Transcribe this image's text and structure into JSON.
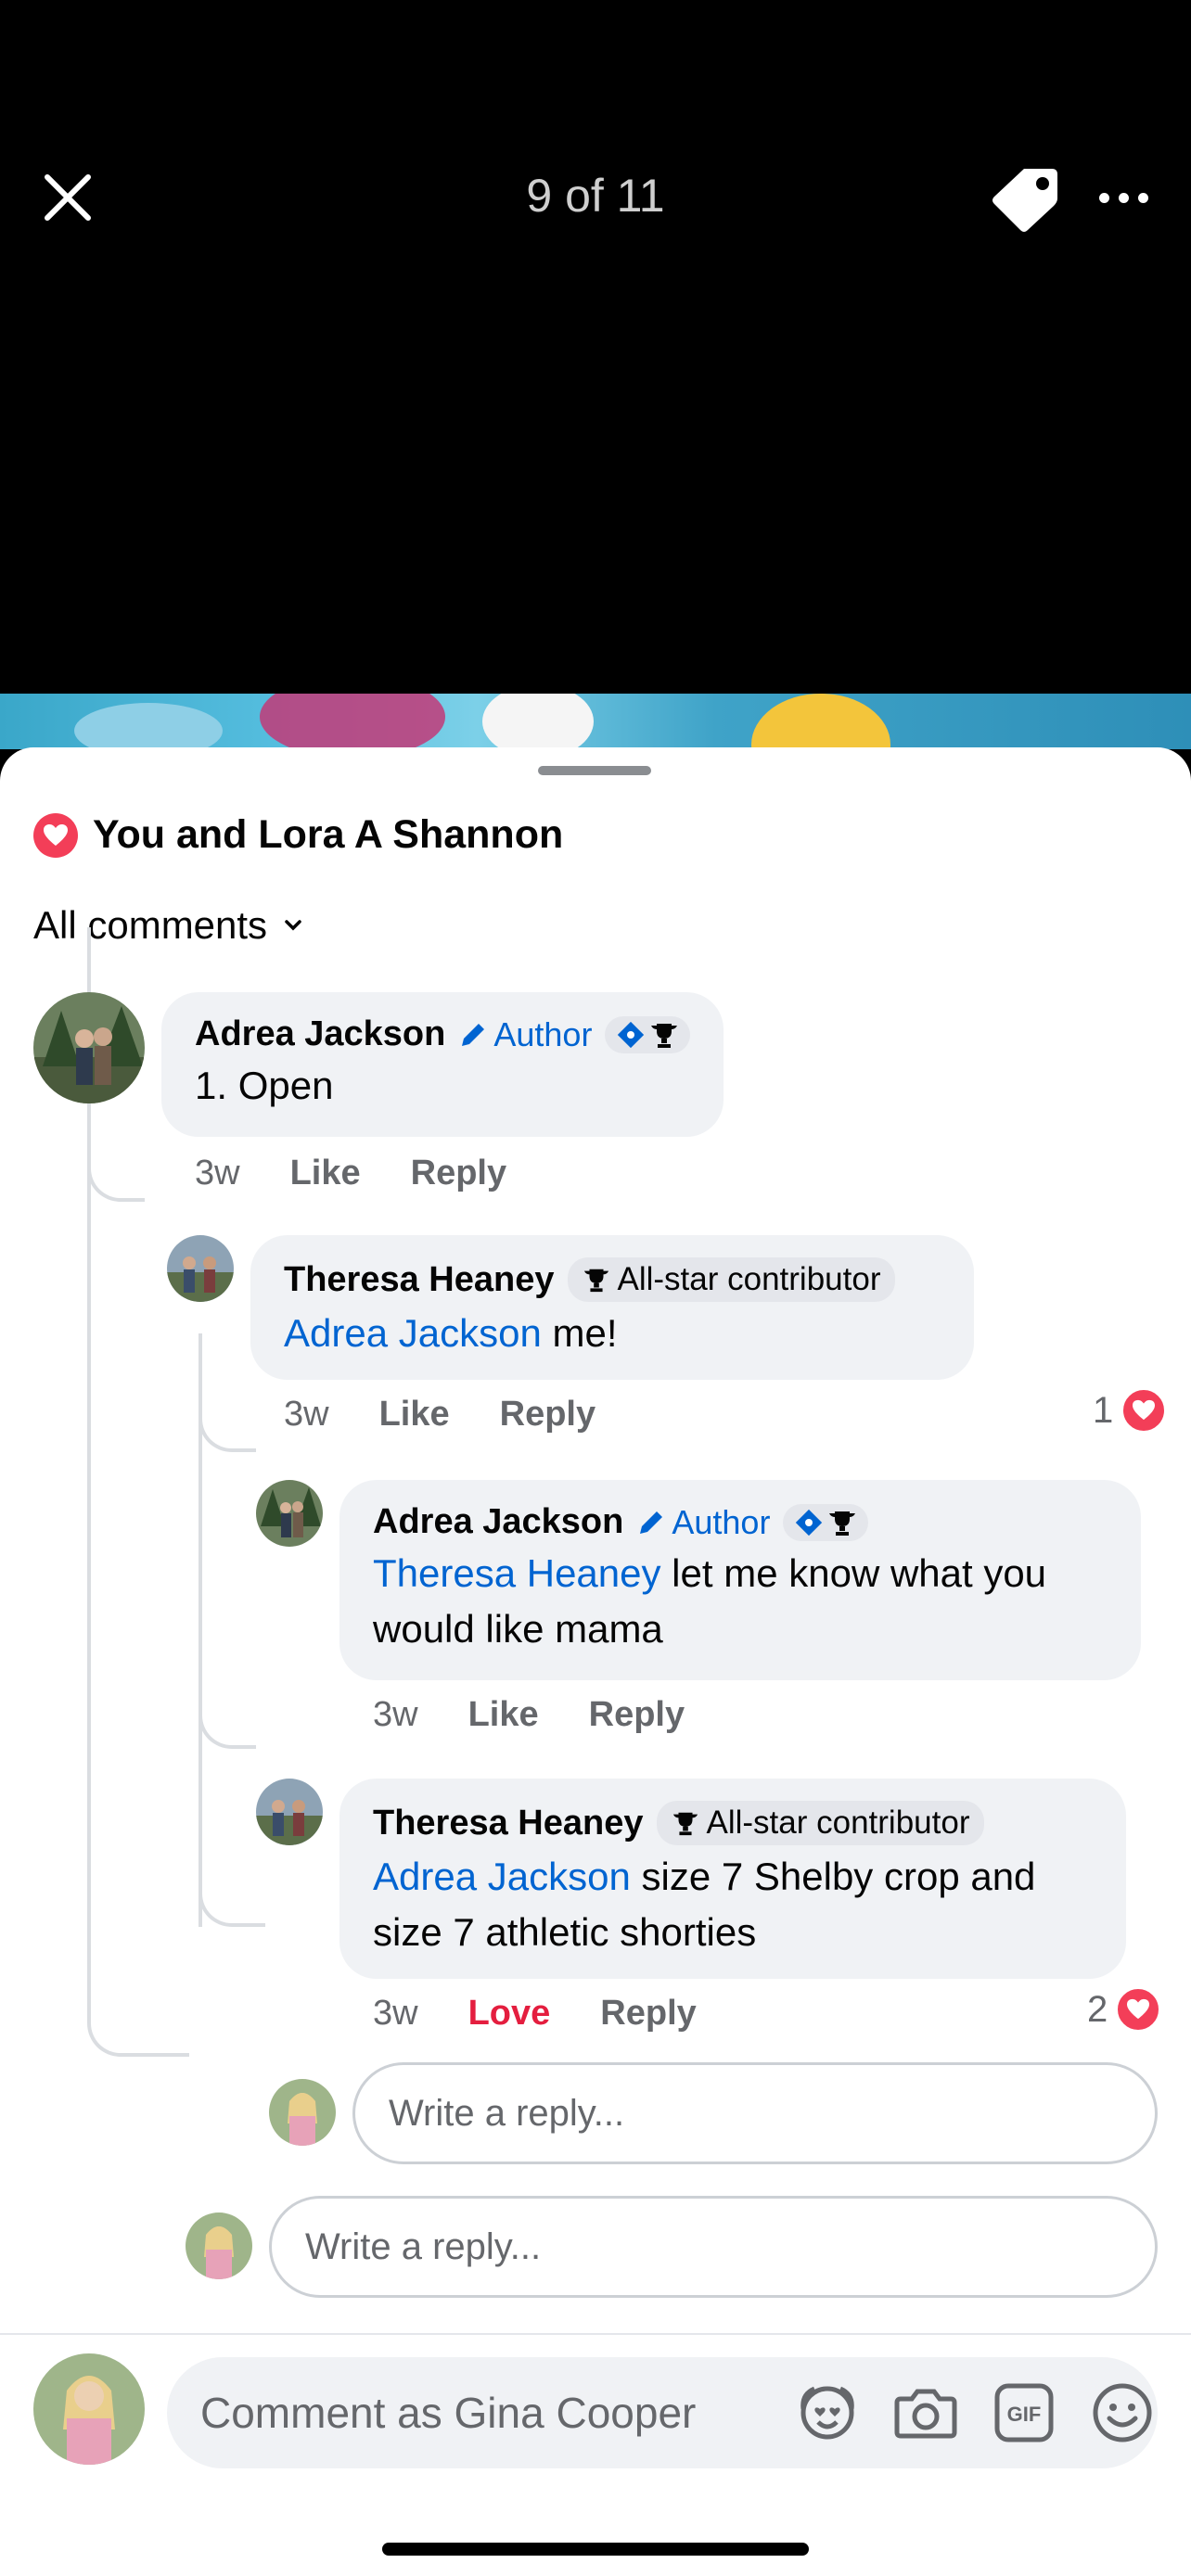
{
  "viewer": {
    "counter": "9 of 11"
  },
  "reactions_summary": {
    "text": "You and Lora A Shannon"
  },
  "filter": {
    "label": "All comments"
  },
  "comments": [
    {
      "name": "Adrea Jackson",
      "badge": "Author",
      "text": "1. Open",
      "time": "3w",
      "like": "Like",
      "reply": "Reply"
    },
    {
      "name": "Theresa Heaney",
      "badge": "All-star contributor",
      "mention": "Adrea Jackson",
      "text": " me!",
      "time": "3w",
      "like": "Like",
      "reply": "Reply",
      "reaction_count": "1"
    },
    {
      "name": "Adrea Jackson",
      "badge": "Author",
      "mention": "Theresa Heaney",
      "text": " let me know what you would like mama",
      "time": "3w",
      "like": "Like",
      "reply": "Reply"
    },
    {
      "name": "Theresa Heaney",
      "badge": "All-star contributor",
      "mention": "Adrea Jackson",
      "text": " size 7 Shelby crop and size 7 athletic shorties",
      "time": "3w",
      "like": "Love",
      "reply": "Reply",
      "reaction_count": "2"
    }
  ],
  "reply_inputs": {
    "nested_placeholder": "Write a reply...",
    "thread_placeholder": "Write a reply..."
  },
  "composer": {
    "placeholder": "Comment as Gina Cooper",
    "icons": [
      "avatar-sticker-icon",
      "camera-icon",
      "gif-icon",
      "emoji-icon"
    ]
  },
  "colors": {
    "link": "#0064d1",
    "love": "#e41e3f",
    "heart": "#f33e58",
    "bubble": "#f0f2f5"
  }
}
